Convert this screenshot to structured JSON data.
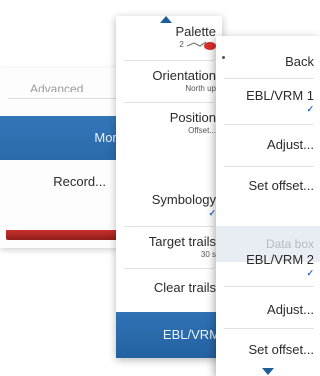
{
  "panel1": {
    "fragment_label": "Advanced",
    "more_label": "More",
    "record_label": "Record..."
  },
  "panel2": {
    "palette": {
      "label": "Palette",
      "value": "2"
    },
    "orientation": {
      "label": "Orientation",
      "value": "North up"
    },
    "position": {
      "label": "Position",
      "value": "Offset..."
    },
    "symbology": {
      "label": "Symbology",
      "check": "✓"
    },
    "target_trails": {
      "label": "Target trails",
      "value": "30 s"
    },
    "clear_trails": {
      "label": "Clear trails"
    },
    "ebl_vrm": {
      "label": "EBL/VRM"
    }
  },
  "panel3": {
    "back_label": "Back",
    "ebl1": {
      "label": "EBL/VRM 1",
      "check": "✓"
    },
    "adjust1_label": "Adjust...",
    "setoffset1_label": "Set offset...",
    "databox_label": "Data box",
    "ebl2": {
      "label": "EBL/VRM 2",
      "check": "✓"
    },
    "adjust2_label": "Adjust...",
    "setoffset2_label": "Set offset..."
  },
  "colors": {
    "selection_blue": "#2a6aaa",
    "check_blue": "#2d6fb3",
    "alert_red": "#c9302c"
  }
}
